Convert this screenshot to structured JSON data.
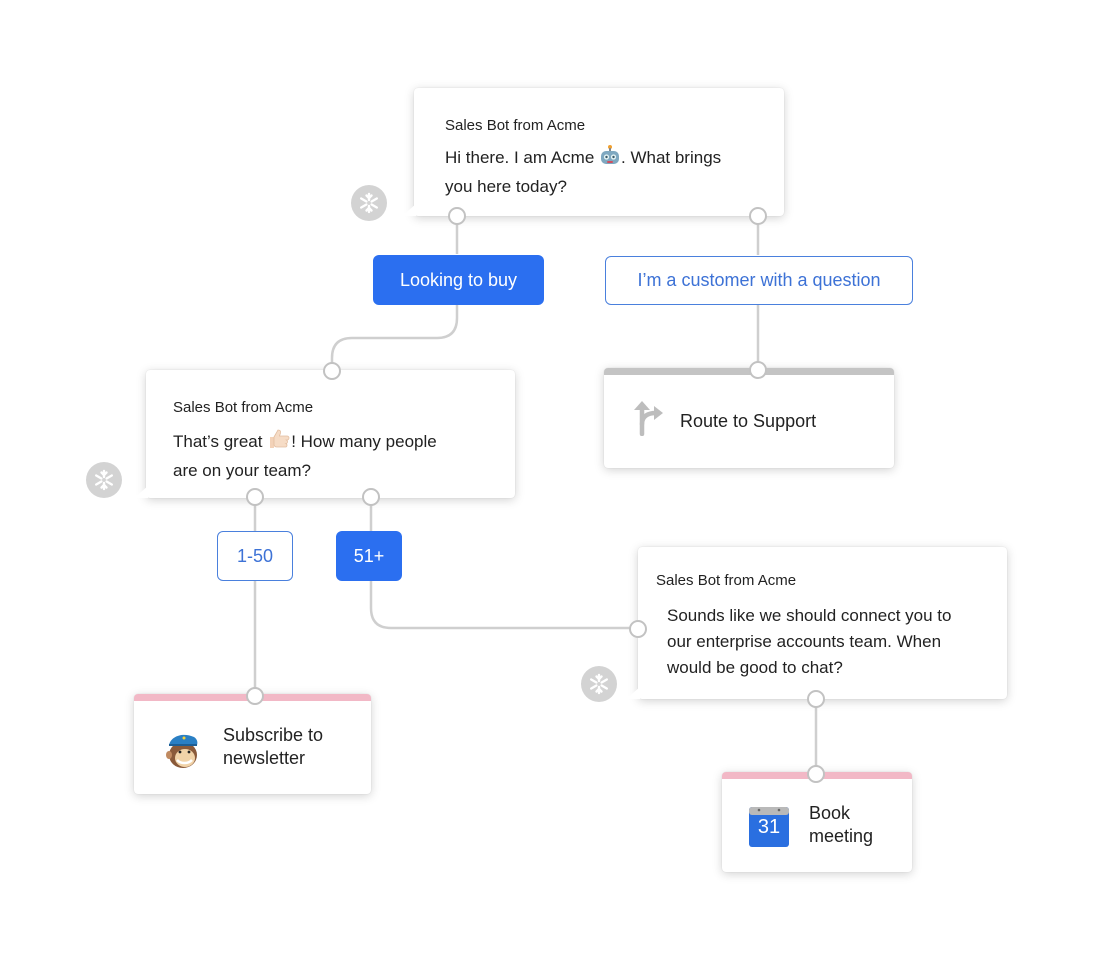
{
  "colors": {
    "primary_blue": "#2b6ff0",
    "outline_blue": "#4a80dd",
    "connector_gray": "#cfcfcf",
    "support_bar_gray": "#c4c4c4",
    "integration_bar_pink": "#f2b8c6"
  },
  "messages": [
    {
      "id": "greeting",
      "sender": "Sales Bot from Acme",
      "text_before_emoji": "Hi there. I am Acme ",
      "emoji": "robot-face",
      "text_after_emoji": ". What brings",
      "text_line2": "you here today?"
    },
    {
      "id": "team-size",
      "sender": "Sales Bot from Acme",
      "text_before_emoji": "That’s great ",
      "emoji": "thumbs-up",
      "text_after_emoji": "! How many people",
      "text_line2": "are on your team?"
    },
    {
      "id": "enterprise",
      "sender": "Sales Bot from Acme",
      "line1": "Sounds like we should connect you to",
      "line2": "our enterprise accounts team. When",
      "line3": "would be good to chat?"
    }
  ],
  "replies": {
    "looking_to_buy": "Looking to buy",
    "customer_question": "I’m a customer with a question",
    "size_small": "1-50",
    "size_large": "51+"
  },
  "actions": {
    "route_support": {
      "label": "Route to Support",
      "icon": "route-split-icon"
    },
    "newsletter": {
      "line1": "Subscribe to",
      "line2": "newsletter",
      "icon": "mailchimp-icon"
    },
    "book_meeting": {
      "line1": "Book",
      "line2": "meeting",
      "icon": "google-calendar-icon",
      "calendar_day": "31"
    }
  }
}
